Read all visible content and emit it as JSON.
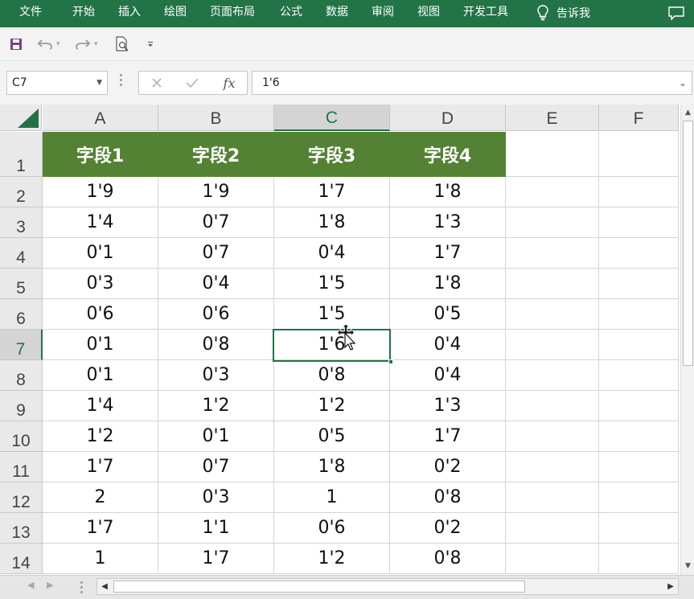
{
  "ribbon": {
    "tabs": [
      "文件",
      "开始",
      "插入",
      "绘图",
      "页面布局",
      "公式",
      "数据",
      "审阅",
      "视图",
      "开发工具"
    ],
    "tell_me": "告诉我",
    "accent": "#227447"
  },
  "quick_access": {
    "save": "save-icon",
    "undo": "undo-icon",
    "redo": "redo-icon",
    "print_preview": "print-preview-icon",
    "customize": "customize-qat-icon"
  },
  "formula_bar": {
    "name_box": "C7",
    "fx_label": "fx",
    "formula": "1'6"
  },
  "sheet": {
    "columns": [
      "A",
      "B",
      "C",
      "D",
      "E",
      "F"
    ],
    "selected_column": "C",
    "row_numbers": [
      "1",
      "2",
      "3",
      "4",
      "5",
      "6",
      "7",
      "8",
      "9",
      "10",
      "11",
      "12",
      "13",
      "14"
    ],
    "selected_row": "7",
    "header_fill": "#548235",
    "headers": [
      "字段1",
      "字段2",
      "字段3",
      "字段4"
    ],
    "rows": [
      [
        "1'9",
        "1'9",
        "1'7",
        "1'8"
      ],
      [
        "1'4",
        "0'7",
        "1'8",
        "1'3"
      ],
      [
        "0'1",
        "0'7",
        "0'4",
        "1'7"
      ],
      [
        "0'3",
        "0'4",
        "1'5",
        "1'8"
      ],
      [
        "0'6",
        "0'6",
        "1'5",
        "0'5"
      ],
      [
        "0'1",
        "0'8",
        "1'6",
        "0'4"
      ],
      [
        "0'1",
        "0'3",
        "0'8",
        "0'4"
      ],
      [
        "1'4",
        "1'2",
        "1'2",
        "1'3"
      ],
      [
        "1'2",
        "0'1",
        "0'5",
        "1'7"
      ],
      [
        "1'7",
        "0'7",
        "1'8",
        "0'2"
      ],
      [
        "2",
        "0'3",
        "1",
        "0'8"
      ],
      [
        "1'7",
        "1'1",
        "0'6",
        "0'2"
      ],
      [
        "1",
        "1'7",
        "1'2",
        "0'8"
      ]
    ],
    "active_cell": "C7"
  }
}
